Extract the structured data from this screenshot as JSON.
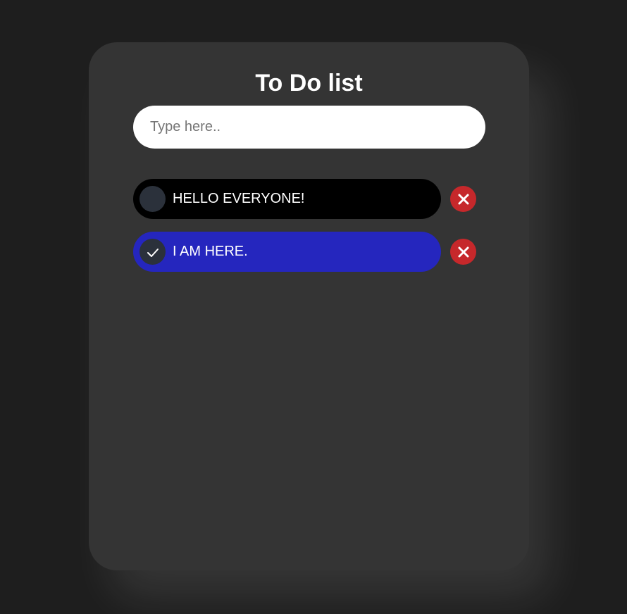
{
  "app": {
    "title": "To Do list"
  },
  "input": {
    "placeholder": "Type here..",
    "value": ""
  },
  "todos": [
    {
      "text": "HELLO EVERYONE!",
      "done": false,
      "bg": "#000000"
    },
    {
      "text": "I AM HERE.",
      "done": true,
      "bg": "#2526be"
    }
  ],
  "colors": {
    "delete": "#c6282b",
    "check_circle": "#2b313b"
  },
  "icons": {
    "check": "check-icon",
    "delete": "close-icon"
  }
}
